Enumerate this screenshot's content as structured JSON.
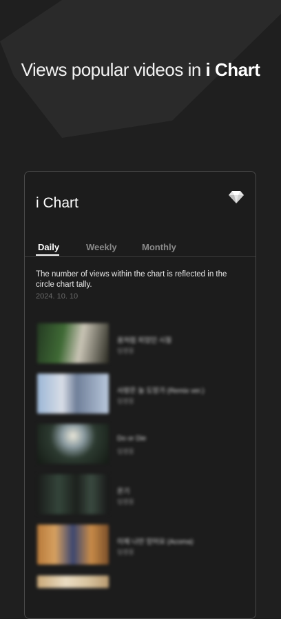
{
  "headline": {
    "prefix": "Views popular videos in ",
    "brand": "i Chart"
  },
  "card": {
    "title": "i Chart",
    "badge_icon": "diamond-icon"
  },
  "tabs": [
    {
      "label": "Daily",
      "active": true
    },
    {
      "label": "Weekly",
      "active": false
    },
    {
      "label": "Monthly",
      "active": false
    }
  ],
  "notice": "The number of views within the chart is reflected in the circle chart tally.",
  "date": "2024. 10. 10",
  "videos": [
    {
      "title": "꿈처럼 피었던 시절",
      "artist": "임영웅"
    },
    {
      "title": "사랑은 늘 도망가 (Remix ver.)",
      "artist": "임영웅"
    },
    {
      "title": "Do or Die",
      "artist": "임영웅"
    },
    {
      "title": "온기",
      "artist": "임영웅"
    },
    {
      "title": "이제 나만 믿어요 (Acoma)",
      "artist": "임영웅"
    },
    {
      "title": "",
      "artist": ""
    }
  ]
}
